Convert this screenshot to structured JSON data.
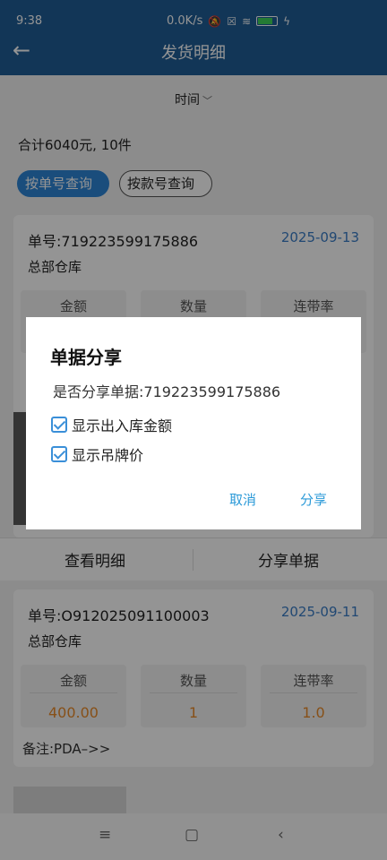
{
  "status_bar": {
    "time": "9:38",
    "net_speed": "0.0K/s",
    "battery_level": "99"
  },
  "header": {
    "title": "发货明细",
    "back_icon": "arrow-left-icon"
  },
  "filter": {
    "time_label": "时间",
    "chevron_icon": "chevron-down-icon"
  },
  "summary": {
    "text": "合计6040元, 10件"
  },
  "query_tabs": [
    {
      "label": "按单号查询",
      "active": true
    },
    {
      "label": "按款号查询",
      "active": false
    }
  ],
  "records": [
    {
      "order_no": "单号:719223599175886",
      "date": "2025-09-13",
      "warehouse": "总部仓库",
      "stats": [
        {
          "label": "金额",
          "value": ""
        },
        {
          "label": "数量",
          "value": ""
        },
        {
          "label": "连带率",
          "value": ""
        }
      ]
    },
    {
      "order_no": "单号:O912025091100003",
      "date": "2025-09-11",
      "warehouse": "总部仓库",
      "stats": [
        {
          "label": "金额",
          "value": "400.00"
        },
        {
          "label": "数量",
          "value": "1"
        },
        {
          "label": "连带率",
          "value": "1.0"
        }
      ],
      "remark": "备注:PDA–>>"
    }
  ],
  "actions": {
    "view_detail": "查看明细",
    "share_order": "分享单据"
  },
  "dialog": {
    "title": "单据分享",
    "message": "是否分享单据:719223599175886",
    "options": [
      {
        "label": "显示出入库金额",
        "checked": true
      },
      {
        "label": "显示吊牌价",
        "checked": true
      }
    ],
    "cancel_label": "取消",
    "share_label": "分享"
  },
  "colors": {
    "header": "#1f5e97",
    "accent": "#2e86d6",
    "value": "#e98b2a",
    "date": "#3a7dc6"
  }
}
